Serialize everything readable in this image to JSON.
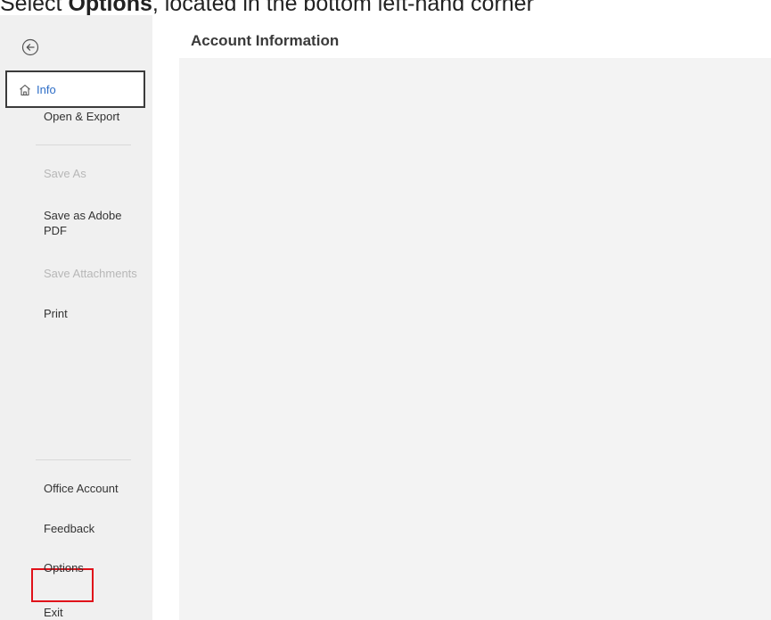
{
  "caption": {
    "prefix": "Select ",
    "bold": "Options",
    "suffix": ", located in the bottom left-hand corner"
  },
  "sidebar": {
    "back_icon": "back-arrow-circle-icon",
    "selected": {
      "icon": "home-icon",
      "label": "Info"
    },
    "items": [
      {
        "label": "Open & Export",
        "disabled": false
      },
      {
        "label": "Save As",
        "disabled": true
      },
      {
        "label": "Save as Adobe PDF",
        "disabled": false
      },
      {
        "label": "Save Attachments",
        "disabled": true
      },
      {
        "label": "Print",
        "disabled": false
      }
    ],
    "bottom_items": [
      {
        "label": "Office Account"
      },
      {
        "label": "Feedback"
      },
      {
        "label": "Options",
        "highlighted": true,
        "highlight_color": "#e0121a"
      },
      {
        "label": "Exit"
      }
    ]
  },
  "main": {
    "title": "Account Information"
  },
  "colors": {
    "accent": "#2e6ec7",
    "sidebar_bg": "#f0f0f0",
    "panel_bg": "#f3f3f3",
    "highlight": "#e0121a"
  }
}
